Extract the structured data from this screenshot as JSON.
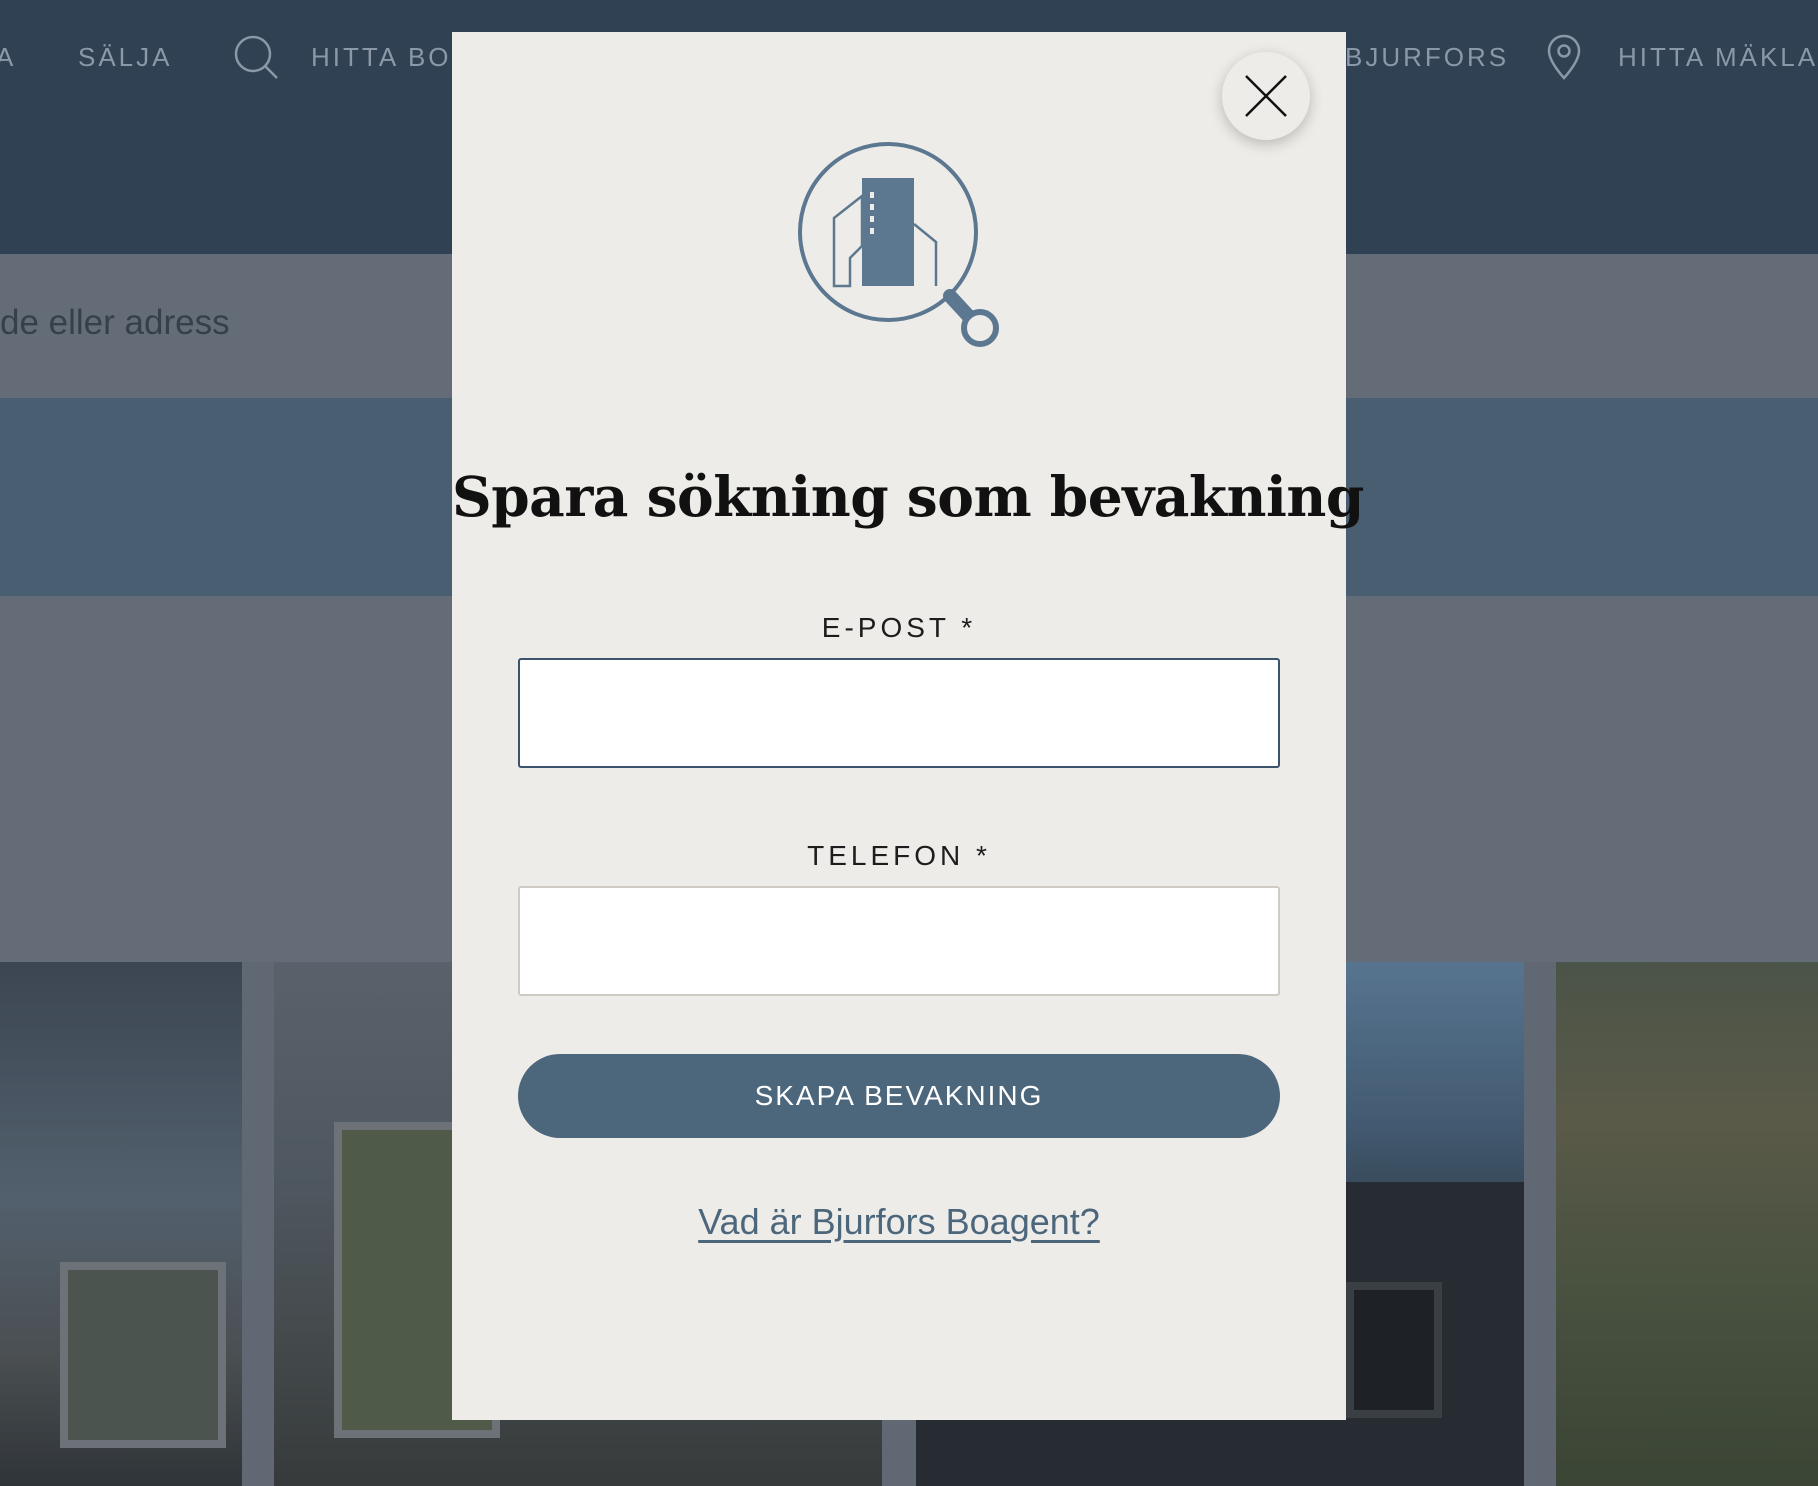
{
  "nav": {
    "item_partial_left": "A",
    "sell": "SÄLJA",
    "find_home": "HITTA BO",
    "brand_partial": "BJURFORS",
    "find_agent": "HITTA MÄKLARE"
  },
  "search": {
    "placeholder_partial": "de eller adress"
  },
  "modal": {
    "title": "Spara sökning som bevakning",
    "email_label": "E-POST *",
    "email_value": "",
    "phone_label": "TELEFON *",
    "phone_value": "",
    "submit_label": "SKAPA BEVAKNING",
    "help_link": "Vad är Bjurfors Boagent?"
  },
  "colors": {
    "nav_bg": "#2f4152",
    "modal_bg": "#eeece9",
    "accent": "#4c667c",
    "logo": "#5c7890"
  }
}
